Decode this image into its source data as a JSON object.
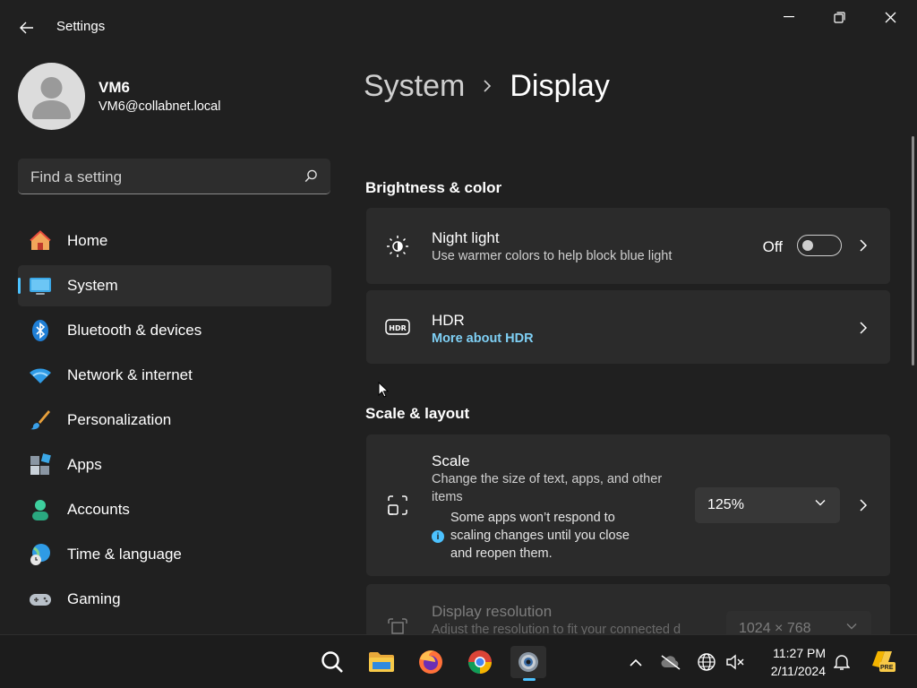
{
  "app": {
    "title": "Settings"
  },
  "user": {
    "name": "VM6",
    "email": "VM6@collabnet.local"
  },
  "search": {
    "placeholder": "Find a setting"
  },
  "nav": {
    "items": [
      {
        "label": "Home",
        "icon": "home-icon"
      },
      {
        "label": "System",
        "icon": "monitor-icon",
        "active": true
      },
      {
        "label": "Bluetooth & devices",
        "icon": "bluetooth-icon"
      },
      {
        "label": "Network & internet",
        "icon": "wifi-icon"
      },
      {
        "label": "Personalization",
        "icon": "brush-icon"
      },
      {
        "label": "Apps",
        "icon": "apps-icon"
      },
      {
        "label": "Accounts",
        "icon": "person-icon"
      },
      {
        "label": "Time & language",
        "icon": "globe-clock-icon"
      },
      {
        "label": "Gaming",
        "icon": "gamepad-icon"
      }
    ]
  },
  "breadcrumb": {
    "parent": "System",
    "current": "Display"
  },
  "sections": {
    "brightness": {
      "title": "Brightness & color"
    },
    "scale_layout": {
      "title": "Scale & layout"
    }
  },
  "night_light": {
    "title": "Night light",
    "subtitle": "Use warmer colors to help block blue light",
    "state_label": "Off",
    "enabled": false
  },
  "hdr": {
    "title": "HDR",
    "link": "More about HDR"
  },
  "scale": {
    "title": "Scale",
    "subtitle_line1": "Change the size of text, apps, and other",
    "subtitle_line2": "items",
    "note_line1": "Some apps won’t respond to",
    "note_line2": "scaling changes until you close",
    "note_line3": "and reopen them.",
    "value": "125%"
  },
  "resolution": {
    "title": "Display resolution",
    "subtitle": "Adjust the resolution to fit your connected d",
    "value": "1024 × 768"
  },
  "taskbar": {
    "apps": [
      "search-icon",
      "file-explorer-icon",
      "firefox-icon",
      "chrome-icon",
      "settings-icon"
    ],
    "clock": {
      "time": "11:27 PM",
      "date": "2/11/2024"
    },
    "pre_badge": "PRE"
  },
  "colors": {
    "accent": "#4cc2ff",
    "link": "#7fd0f5",
    "background": "#202020",
    "card": "#2b2b2b"
  }
}
